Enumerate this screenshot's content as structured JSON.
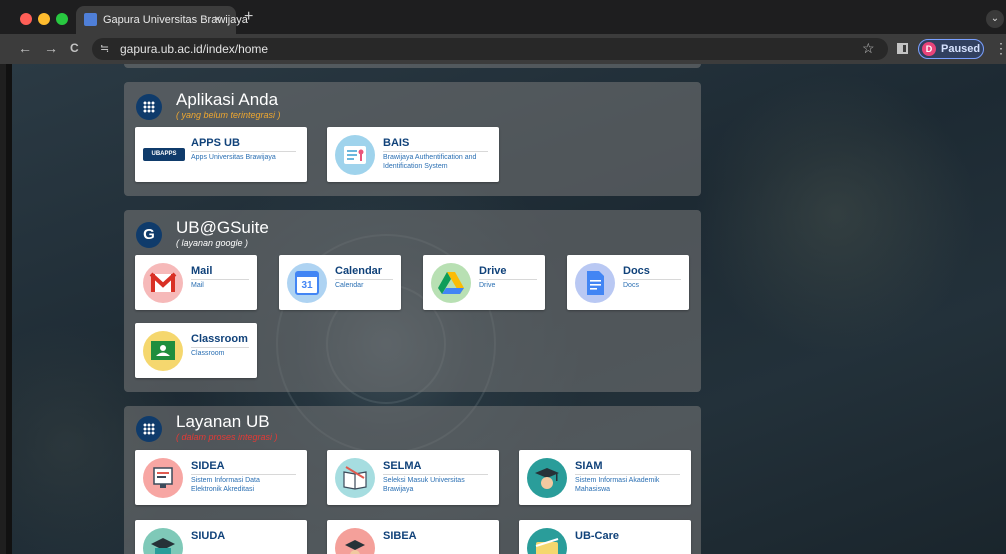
{
  "browser": {
    "tab_title": "Gapura Universitas Brawijaya",
    "tab_close": "×",
    "new_tab": "+",
    "url": "gapura.ub.ac.id/index/home",
    "profile_initial": "D",
    "profile_label": "Paused",
    "back": "←",
    "forward": "→",
    "reload": "C",
    "site_info": "≒",
    "star": "☆",
    "menu": "⋮",
    "tab_menu": "⌄"
  },
  "sections": {
    "aplikasi": {
      "title": "Aplikasi Anda",
      "subtitle": "( yang belum terintegrasi )",
      "cards": [
        {
          "title": "APPS UB",
          "desc": "Apps Universitas Brawijaya",
          "logo_text": "UBAPPS"
        },
        {
          "title": "BAIS",
          "desc": "Brawijaya Authentification and Identification System"
        }
      ]
    },
    "gsuite": {
      "icon": "G",
      "title": "UB@GSuite",
      "subtitle": "( layanan google )",
      "cards": [
        {
          "title": "Mail",
          "desc": "Mail"
        },
        {
          "title": "Calendar",
          "desc": "Calendar",
          "logo_text": "31"
        },
        {
          "title": "Drive",
          "desc": "Drive"
        },
        {
          "title": "Docs",
          "desc": "Docs"
        },
        {
          "title": "Classroom",
          "desc": "Classroom"
        }
      ]
    },
    "layanan": {
      "title": "Layanan UB",
      "subtitle": "( dalam proses integrasi )",
      "cards": [
        {
          "title": "SIDEA",
          "desc": "Sistem Informasi Data Elektronik Akreditasi"
        },
        {
          "title": "SELMA",
          "desc": "Seleksi Masuk Universitas Brawijaya"
        },
        {
          "title": "SIAM",
          "desc": "Sistem Informasi Akademik Mahasiswa"
        },
        {
          "title": "SIUDA",
          "desc": ""
        },
        {
          "title": "SIBEA",
          "desc": ""
        },
        {
          "title": "UB-Care",
          "desc": ""
        }
      ]
    }
  },
  "colors": {
    "title_blue": "#10427a",
    "desc_blue": "#2a6fb3",
    "subtitle_orange": "#f0a830",
    "subtitle_red": "#e53935",
    "icon_navy": "#0f3b6b"
  }
}
